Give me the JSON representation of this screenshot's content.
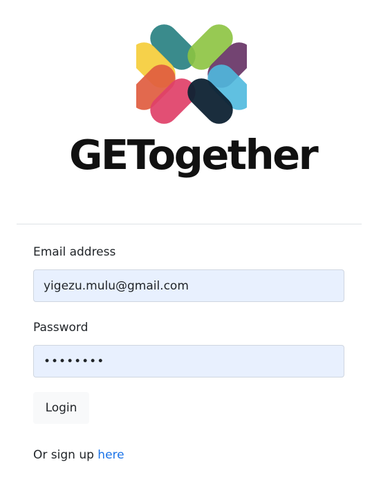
{
  "logo": {
    "wordmark": "GETogether",
    "colors": {
      "teal": "#2f8586",
      "green": "#8cc340",
      "yellow": "#f5cf40",
      "purple": "#6b3a6a",
      "orange_red": "#e05c3f",
      "light_blue": "#4fb9de",
      "pink": "#e04068",
      "navy": "#0e2233"
    }
  },
  "form": {
    "email_label": "Email address",
    "email_value": "yigezu.mulu@gmail.com",
    "password_label": "Password",
    "password_value": "••••••••",
    "login_label": "Login"
  },
  "signup": {
    "prefix": "Or sign up ",
    "link_text": "here",
    "link_color": "#1a73e8"
  }
}
